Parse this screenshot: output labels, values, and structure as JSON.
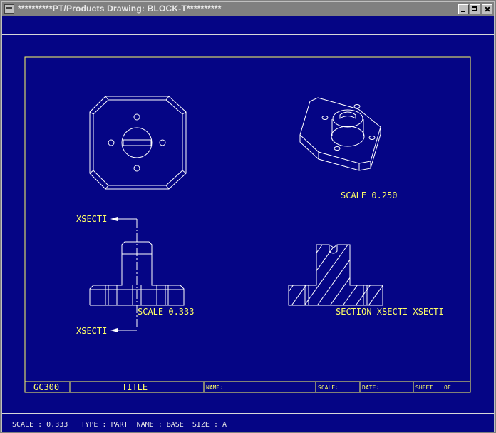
{
  "window": {
    "title": "**********PT/Products Drawing: BLOCK-T**********"
  },
  "drawing": {
    "scale_iso": "SCALE  0.250",
    "scale_main": "SCALE  0.333",
    "xsect_label_top": "XSECTI",
    "xsect_label_bottom": "XSECTI",
    "section_label": "SECTION  XSECTI-XSECTI"
  },
  "title_block": {
    "drawing_number": "GC300",
    "title": "TITLE",
    "name": "NAME:",
    "scale": "SCALE:",
    "date": "DATE:",
    "sheet": "SHEET",
    "of": "OF"
  },
  "status": {
    "text": "SCALE : 0.333   TYPE : PART  NAME : BASE  SIZE : A"
  },
  "colors": {
    "background": "#050585",
    "drawing_lines": "#ffffff",
    "annotations": "#ffff66"
  }
}
